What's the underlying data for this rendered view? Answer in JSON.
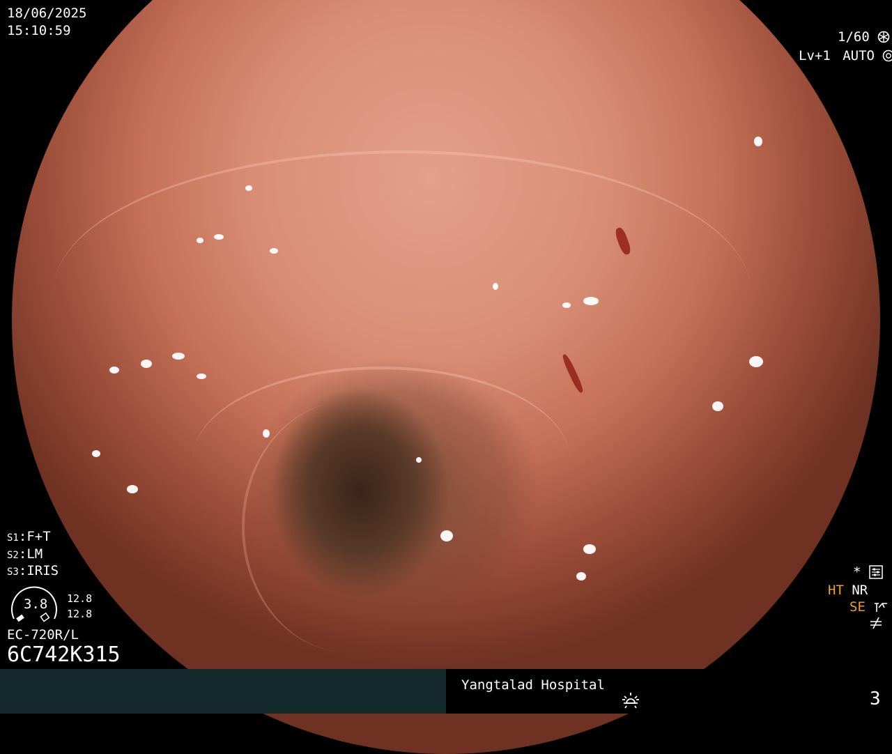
{
  "overlay": {
    "date": "18/06/2025",
    "time": "15:10:59",
    "shutter": "1/60",
    "level": "Lv+1",
    "exposure_mode": "AUTO",
    "settings": {
      "s1_key": "S1",
      "s1_value": "F+T",
      "s2_key": "S2",
      "s2_value": "LM",
      "s3_key": "S3",
      "s3_value": "IRIS"
    },
    "gauge_value": "3.8",
    "gauge_top": "12.8",
    "gauge_bottom": "12.8",
    "scope_model": "EC-720R/L",
    "scope_serial": "6C742K315",
    "right_indicators": {
      "star": "*",
      "ht": "HT",
      "nr": "NR",
      "se": "SE"
    }
  },
  "footer": {
    "hospital": "Yangtalad Hospital",
    "page_number": "3"
  },
  "icons": [
    "shutter-icon",
    "auto-exposure-icon",
    "settings-menu-icon",
    "se-mode-icon",
    "filter-off-icon",
    "brightness-icon",
    "gauge-icon"
  ],
  "colors": {
    "footer_left": "#13292b",
    "accent_orange": "#f0a020",
    "text": "#ffffff"
  }
}
